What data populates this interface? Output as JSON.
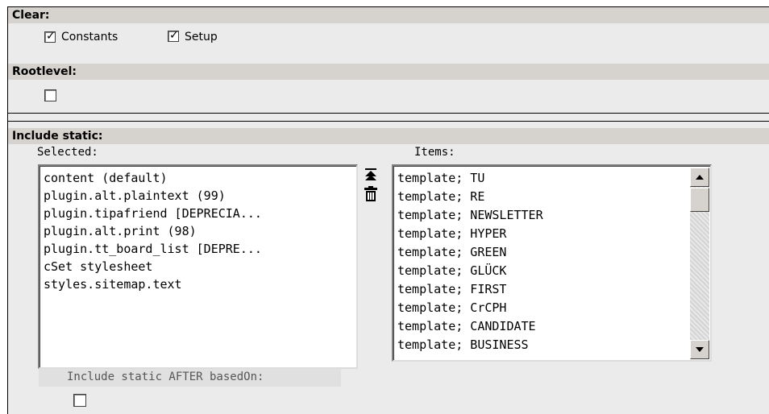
{
  "clear": {
    "header": "Clear:",
    "constants_label": "Constants",
    "constants_checked": true,
    "setup_label": "Setup",
    "setup_checked": true
  },
  "rootlevel": {
    "header": "Rootlevel:",
    "checked": false
  },
  "include_static": {
    "header": "Include static:",
    "selected_label": "Selected:",
    "items_label": "Items:",
    "selected": [
      "content (default)",
      "plugin.alt.plaintext (99)",
      "plugin.tipafriend [DEPRECIA...",
      "plugin.alt.print (98)",
      "plugin.tt_board_list [DEPRE...",
      "cSet stylesheet",
      "styles.sitemap.text"
    ],
    "items": [
      "template; TU",
      "template; RE",
      "template; NEWSLETTER",
      "template; HYPER",
      "template; GREEN",
      "template; GLÜCK",
      "template; FIRST",
      "template; CrCPH",
      "template; CANDIDATE",
      "template; BUSINESS"
    ],
    "move_top_icon": "move-to-top-icon",
    "delete_icon": "trash-icon"
  },
  "after_based_on": {
    "label": "Include static AFTER basedOn:",
    "checked": false
  }
}
